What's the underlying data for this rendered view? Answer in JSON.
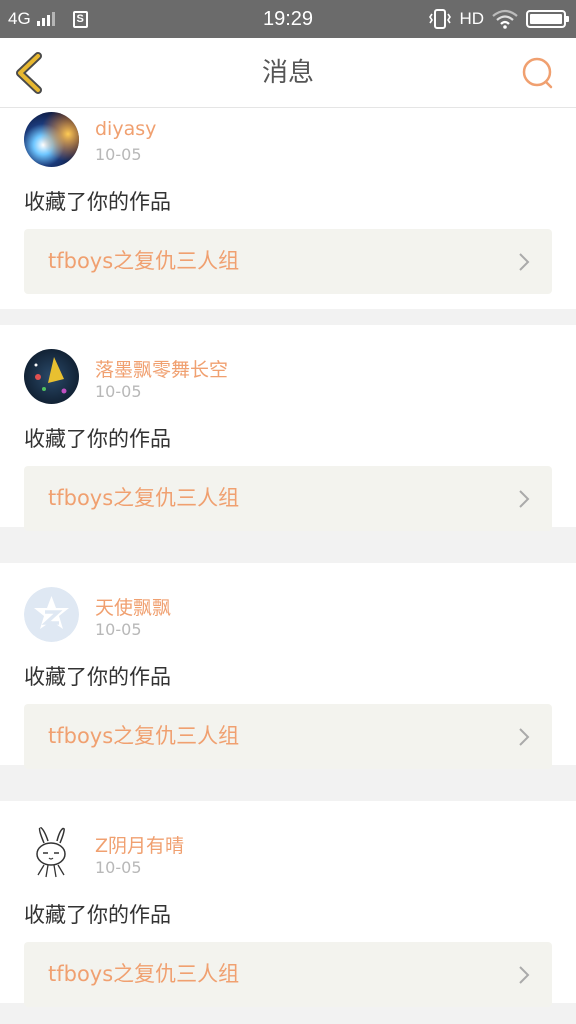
{
  "status_bar": {
    "network": "4G",
    "time": "19:29",
    "hd": "HD"
  },
  "nav": {
    "title": "消息"
  },
  "messages": [
    {
      "username": "diyasy",
      "date": "10-05",
      "action": "收藏了你的作品",
      "work_title": "tfboys之复仇三人组"
    },
    {
      "username": "落墨飘零舞长空",
      "date": "10-05",
      "action": "收藏了你的作品",
      "work_title": "tfboys之复仇三人组"
    },
    {
      "username": "天使飘飘",
      "date": "10-05",
      "action": "收藏了你的作品",
      "work_title": "tfboys之复仇三人组"
    },
    {
      "username": "Z阴月有晴",
      "date": "10-05",
      "action": "收藏了你的作品",
      "work_title": "tfboys之复仇三人组"
    }
  ],
  "colors": {
    "accent": "#f0a070",
    "back_icon": "#e8b830",
    "status_bar": "#6b6b6b"
  },
  "icons": {
    "back": "chevron-left-icon",
    "search": "search-icon",
    "link": "chevron-right-icon"
  }
}
